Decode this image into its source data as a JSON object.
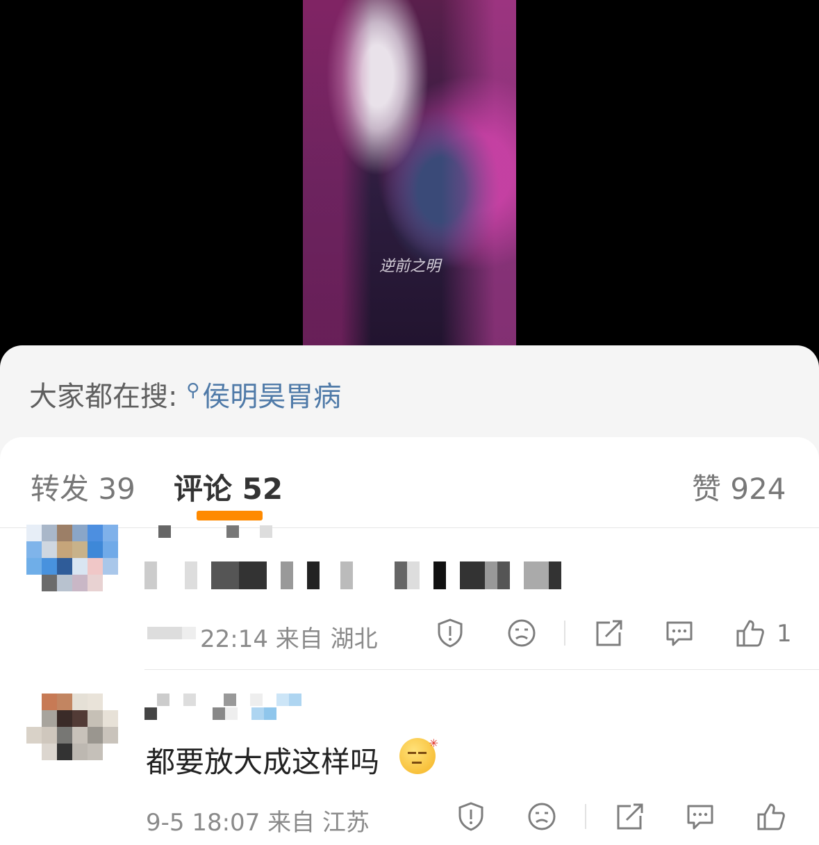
{
  "media": {
    "watermark": "逆前之明"
  },
  "search_hint": {
    "prefix": "大家都在搜: ",
    "keyword": "侯明昊胃病"
  },
  "tabs": [
    {
      "label": "转发 39"
    },
    {
      "label": "评论 52"
    },
    {
      "label": "赞 924"
    }
  ],
  "comments": [
    {
      "meta": "22:14 来自 湖北",
      "like_count": "1",
      "text": ""
    },
    {
      "meta": "9-5 18:07 来自 江苏",
      "like_count": "",
      "text": "都要放大成这样吗"
    }
  ],
  "colors": {
    "tab_indicator": "#ff8a00",
    "link": "#4f7aa8"
  },
  "icons": [
    "search-icon",
    "report-icon",
    "dislike-face-icon",
    "share-icon",
    "reply-icon",
    "like-icon"
  ]
}
